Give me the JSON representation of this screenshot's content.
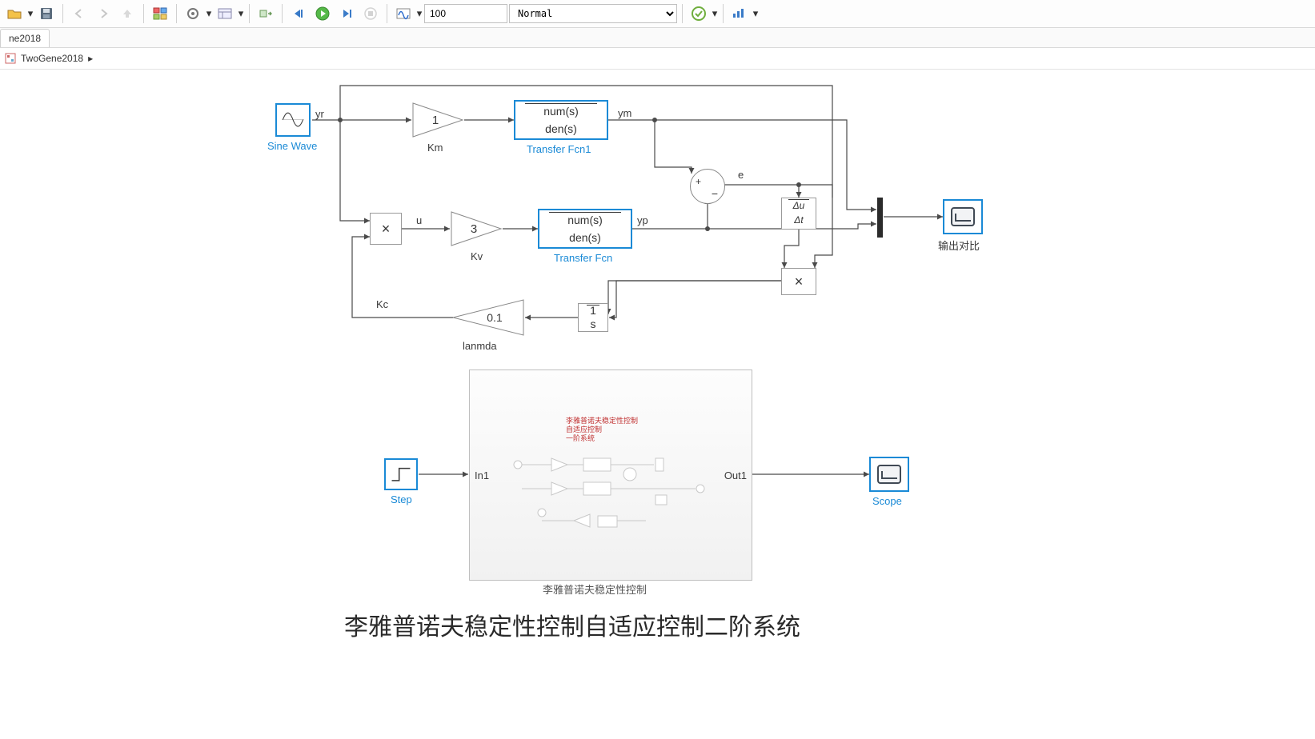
{
  "toolbar": {
    "stop_time": "100",
    "mode": "Normal"
  },
  "tabs": {
    "tab1": "ne2018"
  },
  "breadcrumb": {
    "item1": "TwoGene2018"
  },
  "blocks": {
    "sine": {
      "label": "Sine Wave"
    },
    "km": {
      "value": "1",
      "label": "Km"
    },
    "kv": {
      "value": "3",
      "label": "Kv"
    },
    "lan": {
      "value": "0.1",
      "label": "lanmda",
      "kc": "Kc"
    },
    "tf1": {
      "num": "num(s)",
      "den": "den(s)",
      "label": "Transfer Fcn1"
    },
    "tf": {
      "num": "num(s)",
      "den": "den(s)",
      "label": "Transfer Fcn"
    },
    "deriv": {
      "num": "Δu",
      "den": "Δt"
    },
    "product1": {
      "op": "×"
    },
    "product2": {
      "op": "×"
    },
    "integ": {
      "num": "1",
      "den": "s"
    },
    "scope1": {
      "label": "输出对比"
    },
    "step": {
      "label": "Step"
    },
    "scope2": {
      "label": "Scope"
    },
    "sub": {
      "label": "李雅普诺夫稳定性控制",
      "in": "In1",
      "out": "Out1",
      "red1": "李雅普诺夫稳定性控制",
      "red2": "自适应控制",
      "red3": "一阶系统"
    }
  },
  "signals": {
    "yr": "yr",
    "ym": "ym",
    "u": "u",
    "yp": "yp",
    "e": "e"
  },
  "sum": {
    "plus": "+",
    "minus": "−"
  },
  "footer": "李雅普诺夫稳定性控制自适应控制二阶系统"
}
